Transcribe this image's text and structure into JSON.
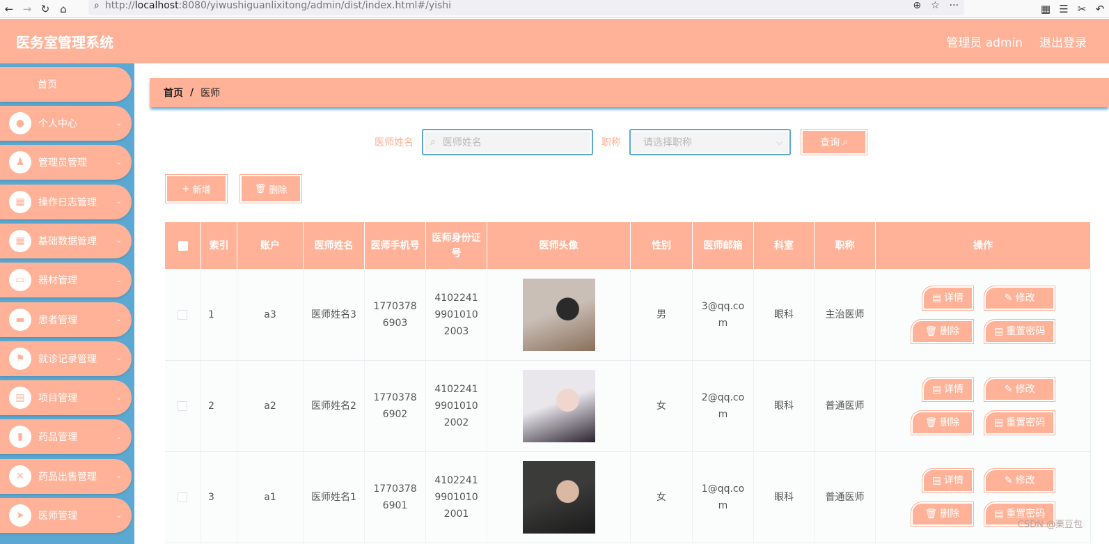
{
  "browser": {
    "url_prefix": "http://",
    "url_host": "localhost",
    "url_rest": ":8080/yiwushiguanlixitong/admin/dist/index.html#/yishi"
  },
  "header": {
    "title": "医务室管理系统",
    "user": "管理员 admin",
    "logout": "退出登录"
  },
  "sidebar": {
    "home": "首页",
    "items": [
      {
        "label": "个人中心",
        "icon": "user-icon"
      },
      {
        "label": "管理员管理",
        "icon": "person-icon"
      },
      {
        "label": "操作日志管理",
        "icon": "grid-icon"
      },
      {
        "label": "基础数据管理",
        "icon": "grid-icon"
      },
      {
        "label": "器材管理",
        "icon": "monitor-icon"
      },
      {
        "label": "患者管理",
        "icon": "chat-icon"
      },
      {
        "label": "就诊记录管理",
        "icon": "flag-icon"
      },
      {
        "label": "项目管理",
        "icon": "clipboard-icon"
      },
      {
        "label": "药品管理",
        "icon": "bar-chart-icon"
      },
      {
        "label": "药品出售管理",
        "icon": "butterfly-icon"
      },
      {
        "label": "医师管理",
        "icon": "send-icon"
      }
    ]
  },
  "breadcrumb": {
    "home": "首页",
    "current": "医师"
  },
  "search": {
    "name_label": "医师姓名",
    "name_placeholder": "医师姓名",
    "title_label": "职称",
    "title_placeholder": "请选择职称",
    "query_button": "查询"
  },
  "actions": {
    "add": "新增",
    "delete": "删除"
  },
  "table": {
    "headers": [
      "索引",
      "账户",
      "医师姓名",
      "医师手机号",
      "医师身份证号",
      "医师头像",
      "性别",
      "医师邮箱",
      "科室",
      "职称",
      "操作"
    ],
    "rows": [
      {
        "index": "1",
        "account": "a3",
        "name": "医师姓名3",
        "phone": "17703786903",
        "id_card": "410224199010102003",
        "gender": "男",
        "email": "3@qq.com",
        "dept": "眼科",
        "title": "主治医师",
        "avatar_colors": [
          "#c9bfb7",
          "#8a6f5b",
          "#2a2a2a"
        ]
      },
      {
        "index": "2",
        "account": "a2",
        "name": "医师姓名2",
        "phone": "17703786902",
        "id_card": "410224199010102002",
        "gender": "女",
        "email": "2@qq.com",
        "dept": "眼科",
        "title": "普通医师",
        "avatar_colors": [
          "#e9e6ec",
          "#2b2430",
          "#f0d6cc"
        ]
      },
      {
        "index": "3",
        "account": "a1",
        "name": "医师姓名1",
        "phone": "17703786901",
        "id_card": "410224199010102001",
        "gender": "女",
        "email": "1@qq.com",
        "dept": "眼科",
        "title": "普通医师",
        "avatar_colors": [
          "#3b3b3a",
          "#1a1a1a",
          "#d9b8a4"
        ]
      }
    ],
    "op_labels": {
      "detail": "详情",
      "edit": "修改",
      "delete": "删除",
      "reset": "重置密码"
    }
  },
  "watermark": "CSDN @栗豆包",
  "colors": {
    "accent": "#ffb297",
    "sidebar": "#5ba9d2"
  }
}
